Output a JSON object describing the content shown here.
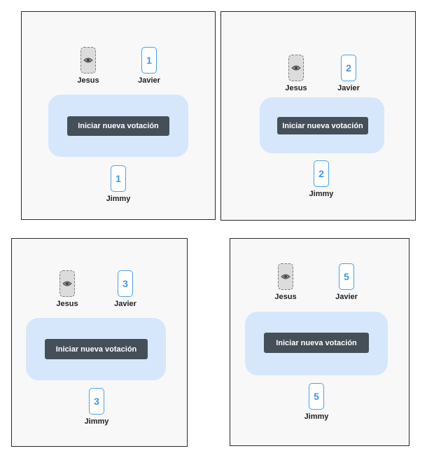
{
  "labels": {
    "start_button": "Iniciar nueva votación"
  },
  "colors": {
    "card_border": "#4aa3ea",
    "card_value": "#3f97e0",
    "table_background": "#d6e7fb",
    "button_background": "#454f58",
    "panel_background": "#f8f8f8"
  },
  "icons": {
    "hidden_card": "eye-icon"
  },
  "panels": [
    {
      "players": [
        {
          "name": "Jesus",
          "card": "hidden"
        },
        {
          "name": "Javier",
          "card": "1"
        },
        {
          "name": "Jimmy",
          "card": "1"
        }
      ]
    },
    {
      "players": [
        {
          "name": "Jesus",
          "card": "hidden"
        },
        {
          "name": "Javier",
          "card": "2"
        },
        {
          "name": "Jimmy",
          "card": "2"
        }
      ]
    },
    {
      "players": [
        {
          "name": "Jesus",
          "card": "hidden"
        },
        {
          "name": "Javier",
          "card": "3"
        },
        {
          "name": "Jimmy",
          "card": "3"
        }
      ]
    },
    {
      "players": [
        {
          "name": "Jesus",
          "card": "hidden"
        },
        {
          "name": "Javier",
          "card": "5"
        },
        {
          "name": "Jimmy",
          "card": "5"
        }
      ]
    }
  ]
}
